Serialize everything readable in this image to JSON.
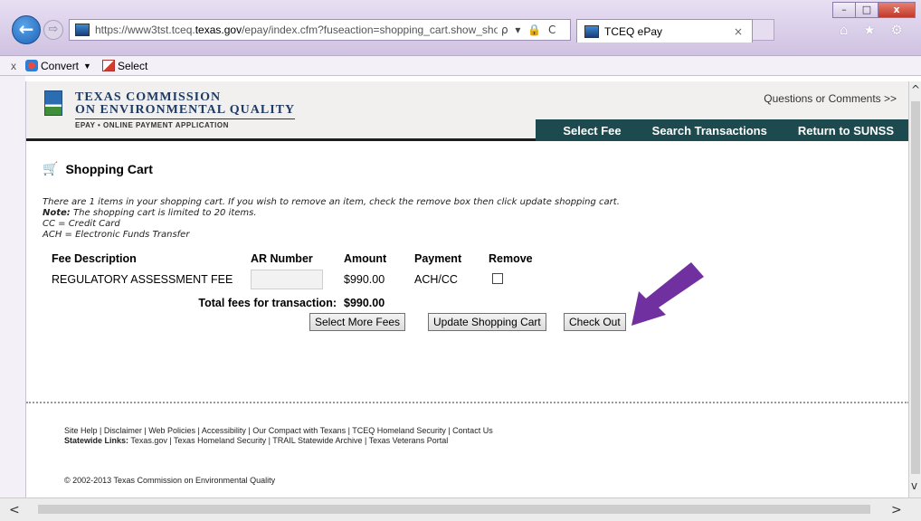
{
  "browser": {
    "url_prefix": "https://www3tst.tceq.",
    "url_domain": "texas.gov",
    "url_suffix": "/epay/index.cfm?fuseaction=shopping_cart.show_shopping",
    "addr_icons": "ρ ▾ 🔒 C",
    "tab_title": "TCEQ ePay",
    "tab_close": "×",
    "toolbar_icons": "⌂ ★ ⚙",
    "win_min": "–",
    "win_max": "□",
    "win_close": "x",
    "back": "←",
    "forward": "⇨"
  },
  "cmdbar": {
    "close": "x",
    "convert": "Convert",
    "select": "Select"
  },
  "header": {
    "org_line1": "TEXAS COMMISSION",
    "org_line2": "ON ENVIRONMENTAL QUALITY",
    "tagline": "EPAY • ONLINE PAYMENT APPLICATION",
    "questions": "Questions or Comments >>",
    "nav": [
      "Select Fee",
      "Search Transactions",
      "Return to SUNSS"
    ]
  },
  "cart": {
    "icon": "🛒",
    "title": "Shopping Cart",
    "intro1": "There are 1 items in your shopping cart. If you wish to remove an item, check the remove box then click update shopping cart.",
    "note_label": "Note:",
    "note_text": " The shopping cart is limited to 20 items.",
    "legend_cc": "CC = Credit Card",
    "legend_ach": "ACH = Electronic Funds Transfer",
    "columns": [
      "Fee Description",
      "AR Number",
      "Amount",
      "Payment",
      "Remove"
    ],
    "rows": [
      {
        "description": "REGULATORY ASSESSMENT FEE",
        "ar_number": "",
        "amount": "$990.00",
        "payment": "ACH/CC",
        "remove": false
      }
    ],
    "total_label": "Total fees for transaction:",
    "total_value": "$990.00",
    "buttons": {
      "select_more": "Select More Fees",
      "update": "Update Shopping Cart",
      "checkout": "Check Out"
    }
  },
  "footer": {
    "links": "Site Help | Disclaimer | Web Policies | Accessibility | Our Compact with Texans | TCEQ Homeland Security | Contact Us",
    "statewide_label": "Statewide Links:",
    "statewide_links": " Texas.gov | Texas Homeland Security | TRAIL Statewide Archive | Texas Veterans Portal",
    "copyright": "© 2002-2013 Texas Commission on Environmental Quality"
  },
  "annotation": {
    "arrow_color": "#7030a0"
  }
}
